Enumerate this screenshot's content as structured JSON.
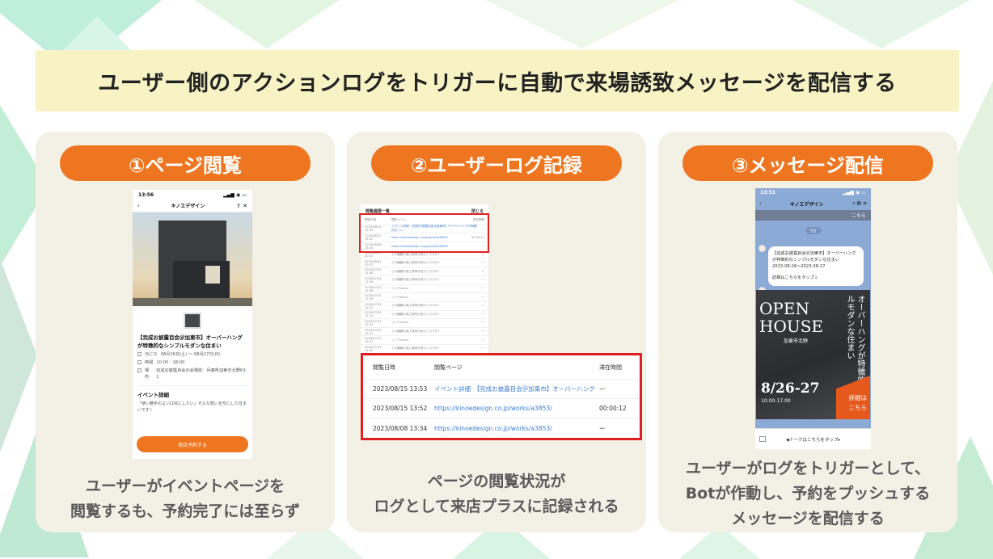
{
  "title": "ユーザー側のアクションログをトリガーに自動で来場誘致メッセージを配信する",
  "steps": [
    {
      "label": "①ページ閲覧",
      "caption": [
        "ユーザーがイベントページを",
        "閲覧するも、予約完了には至らず"
      ]
    },
    {
      "label": "②ユーザーログ記録",
      "caption": [
        "ページの閲覧状況が",
        "ログとして来店プラスに記録される"
      ]
    },
    {
      "label": "③メッセージ配信",
      "caption": [
        "ユーザーがログをトリガーとして、",
        "Botが作動し、予約をプッシュする",
        "メッセージを配信する"
      ]
    }
  ],
  "phone1": {
    "time": "13:56",
    "app_title": "キノエデザイン",
    "event_title": "【完成お披露目会＠加東市】オーバーハングが特徴的なシンプルモダンな住まい",
    "date_label": "日にち",
    "date_value": "08月26日(土) ～ 08月27日(日)",
    "time_label": "時間",
    "time_value": "10:00 - 18:00",
    "place_label": "場所",
    "place_value": "完成お披露目会の会場前：兵庫県加東市北野63-1",
    "section_title": "イベント詳細",
    "section_body": "「使い勝手のよいLDKにしたい」そんな想いを形にした住まいです♪",
    "reserve_button": "来店予約する"
  },
  "log_small": {
    "title": "閲覧履歴一覧",
    "close": "閉じる",
    "headers": [
      "閲覧日時",
      "閲覧ページ",
      "滞在時間"
    ],
    "rows": [
      {
        "date": "2023/08/15 13:53",
        "page": "イベント詳細　【完成お披露目会＠加東市】オーバーハングが特徴的なシン…",
        "stay": "ー",
        "link": true
      },
      {
        "date": "2023/08/15 13:52",
        "page": "https://kinoedesign.co.jp/works/a3853/",
        "stay": "00:00:12",
        "link": true
      },
      {
        "date": "2023/08/08 13:34",
        "page": "https://kinoedesign.co.jp/works/a3853/",
        "stay": "ー",
        "link": true
      },
      {
        "date": "2023/08/01 20:31",
        "page": "どの種類の施工事例が見たいですか？",
        "stay": "ー",
        "link": false
      },
      {
        "date": "2023/08/01 20:31",
        "page": "どの種類の施工事例が見たいですか？",
        "stay": "ー",
        "link": false
      },
      {
        "date": "2023/07/31 11:58",
        "page": "どの種類の施工事例が見たいですか？",
        "stay": "ー",
        "link": false
      },
      {
        "date": "2023/07/31 11:58",
        "page": "どの種類の施工事例が見たいですか？",
        "stay": "ー",
        "link": false
      },
      {
        "date": "2023/07/31 11:58",
        "page": "リッチmenu",
        "stay": "ー",
        "link": false
      },
      {
        "date": "2023/07/31 11:58",
        "page": "リッチmenu",
        "stay": "ー",
        "link": false
      },
      {
        "date": "2023/07/31 11:52",
        "page": "どの種類の施工事例が見たいですか？",
        "stay": "ー",
        "link": false
      },
      {
        "date": "2023/07/31 11:52",
        "page": "どの種類の施工事例が見たいですか？",
        "stay": "ー",
        "link": false
      },
      {
        "date": "2023/07/31 11:52",
        "page": "リッチmenu",
        "stay": "ー",
        "link": false
      },
      {
        "date": "2023/07/31 11:51",
        "page": "どの種類の施工事例が見たいですか？",
        "stay": "ー",
        "link": false
      },
      {
        "date": "2023/07/31 11:51",
        "page": "リッチmenu",
        "stay": "ー",
        "link": false
      },
      {
        "date": "2023/07/31 11:50",
        "page": "どの種類の施工事例が見たいですか？",
        "stay": "ー",
        "link": false
      },
      {
        "date": "2023/07/31 11:50",
        "page": "どの種類の施工事例が見たいですか？",
        "stay": "ー",
        "link": false
      }
    ]
  },
  "log_big": {
    "headers": [
      "閲覧日時",
      "閲覧ページ",
      "滞在時間"
    ],
    "rows": [
      {
        "date": "2023/08/15 13:53",
        "page": "イベント詳細　【完成お披露目会＠加東市】オーバーハングが特徴的なシン…",
        "stay": "ー"
      },
      {
        "date": "2023/08/15 13:52",
        "page": "https://kinoedesign.co.jp/works/a3853/",
        "stay": "00:00:12"
      },
      {
        "date": "2023/08/08 13:34",
        "page": "https://kinoedesign.co.jp/works/a3853/",
        "stay": "ー"
      }
    ]
  },
  "phone3": {
    "time": "13:51",
    "chat_title": "キノエデザイン",
    "top_text": "こちら",
    "date_chip": "今日",
    "bubble_lines": [
      "【完成お披露目会＠加東市】オーバーハングが特徴的なシンプルモダンな住まい",
      "2023-08-26～2023-08-27"
    ],
    "bubble_tap": "詳細はこちらをタップ↓",
    "banner_open": "OPEN",
    "banner_house": "HOUSE",
    "banner_place": "加東市北野",
    "banner_vertical": "オーバーハングが特徴的な シンプルモダンな住まい",
    "banner_date": "8/26-27",
    "banner_time": "10:00-17:00",
    "banner_corner": [
      "詳細は",
      "こちら"
    ],
    "bottom_text": "◀トークはこちらをタップ▸"
  },
  "colors": {
    "accent": "#ef7620",
    "banner_bg": "#f7f3c4",
    "card_bg": "#f3f0e6",
    "highlight": "#e02020",
    "link": "#3a7bd5"
  }
}
